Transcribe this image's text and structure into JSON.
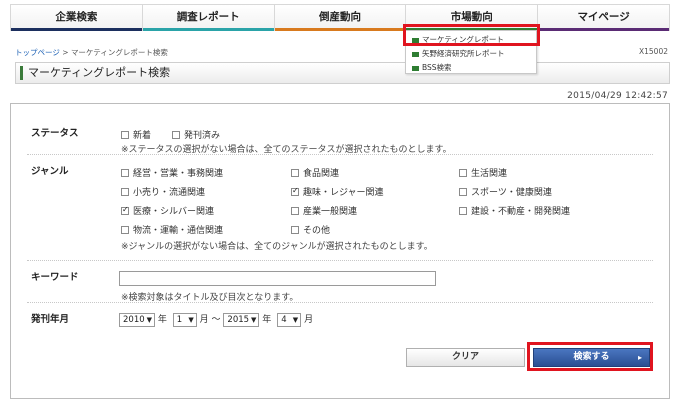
{
  "nav": {
    "items": [
      {
        "label": "企業検索",
        "color": "#1c2f5e"
      },
      {
        "label": "調査レポート",
        "color": "#2aa3a8"
      },
      {
        "label": "倒産動向",
        "color": "#d87a1e"
      },
      {
        "label": "市場動向",
        "color": "#2e7d32"
      },
      {
        "label": "マイページ",
        "color": "#5a2b74"
      }
    ]
  },
  "dropdown": {
    "items": [
      "マーケティングレポート",
      "矢野経済研究所レポート",
      "BSS検索"
    ]
  },
  "breadcrumb": {
    "home": "トップページ",
    "separator": ">",
    "current": "マーケティングレポート検索"
  },
  "page_code": "X15002",
  "page_title": "マーケティングレポート検索",
  "datetime": "2015/04/29 12:42:57",
  "form": {
    "status": {
      "label": "ステータス",
      "options": [
        {
          "label": "新着",
          "checked": false
        },
        {
          "label": "発刊済み",
          "checked": false
        }
      ],
      "note": "※ステータスの選択がない場合は、全てのステータスが選択されたものとします。"
    },
    "genre": {
      "label": "ジャンル",
      "options": [
        {
          "label": "経営・営業・事務関連",
          "checked": false
        },
        {
          "label": "食品関連",
          "checked": false
        },
        {
          "label": "生活関連",
          "checked": false
        },
        {
          "label": "小売り・流通関連",
          "checked": false
        },
        {
          "label": "趣味・レジャー関連",
          "checked": true
        },
        {
          "label": "スポーツ・健康関連",
          "checked": false
        },
        {
          "label": "医療・シルバー関連",
          "checked": true
        },
        {
          "label": "産業一般関連",
          "checked": false
        },
        {
          "label": "建設・不動産・開発関連",
          "checked": false
        },
        {
          "label": "物流・運輸・通信関連",
          "checked": false
        },
        {
          "label": "その他",
          "checked": false
        }
      ],
      "note": "※ジャンルの選択がない場合は、全てのジャンルが選択されたものとします。"
    },
    "keyword": {
      "label": "キーワード",
      "value": "",
      "note": "※検索対象はタイトル及び目次となります。"
    },
    "date": {
      "label": "発刊年月",
      "from_year": "2010",
      "year_unit": "年",
      "from_month": "1",
      "month_unit": "月",
      "tilde": "～",
      "to_year": "2015",
      "to_month": "4"
    },
    "clear_label": "クリア",
    "search_label": "検索する"
  },
  "colors": {
    "highlight": "#e0141f",
    "search_button": "#2a4f93"
  }
}
